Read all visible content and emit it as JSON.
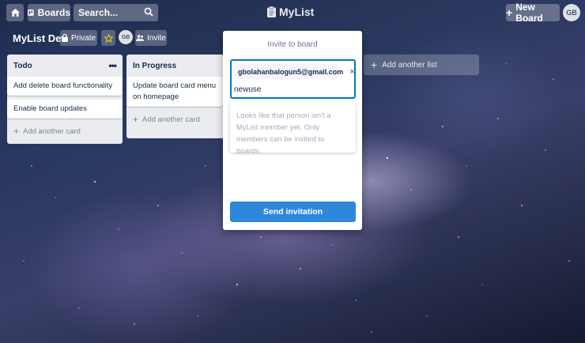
{
  "header": {
    "boards_label": "Boards",
    "search_value": "Search...",
    "app_name": "MyList",
    "new_board_label": "New Board",
    "avatar_initials": "GB"
  },
  "board": {
    "title": "MyList Dev",
    "visibility_label": "Private",
    "member_initials": "GB",
    "invite_label": "Invite"
  },
  "lists": [
    {
      "title": "Todo",
      "menu_icon": "ellipsis-icon",
      "cards": [
        "Add delete board functionality",
        "Enable board updates"
      ],
      "add_card_label": "Add another card"
    },
    {
      "title": "In Progress",
      "cards": [
        "Update board card menu on homepage"
      ],
      "add_card_label": "Add another card"
    }
  ],
  "add_list_label": "Add another list",
  "invite_modal": {
    "title": "Invite to board",
    "chip_email": "gbolahanbalogun5@gmail.com",
    "input_value": "newuse",
    "notice": "Looks like that person isn't a MyList member yet. Only members can be invited to boards.",
    "send_label": "Send invitation"
  },
  "colors": {
    "accent": "#2d88dc",
    "list_bg": "#ebecf0",
    "focus_border": "#0079bf"
  }
}
